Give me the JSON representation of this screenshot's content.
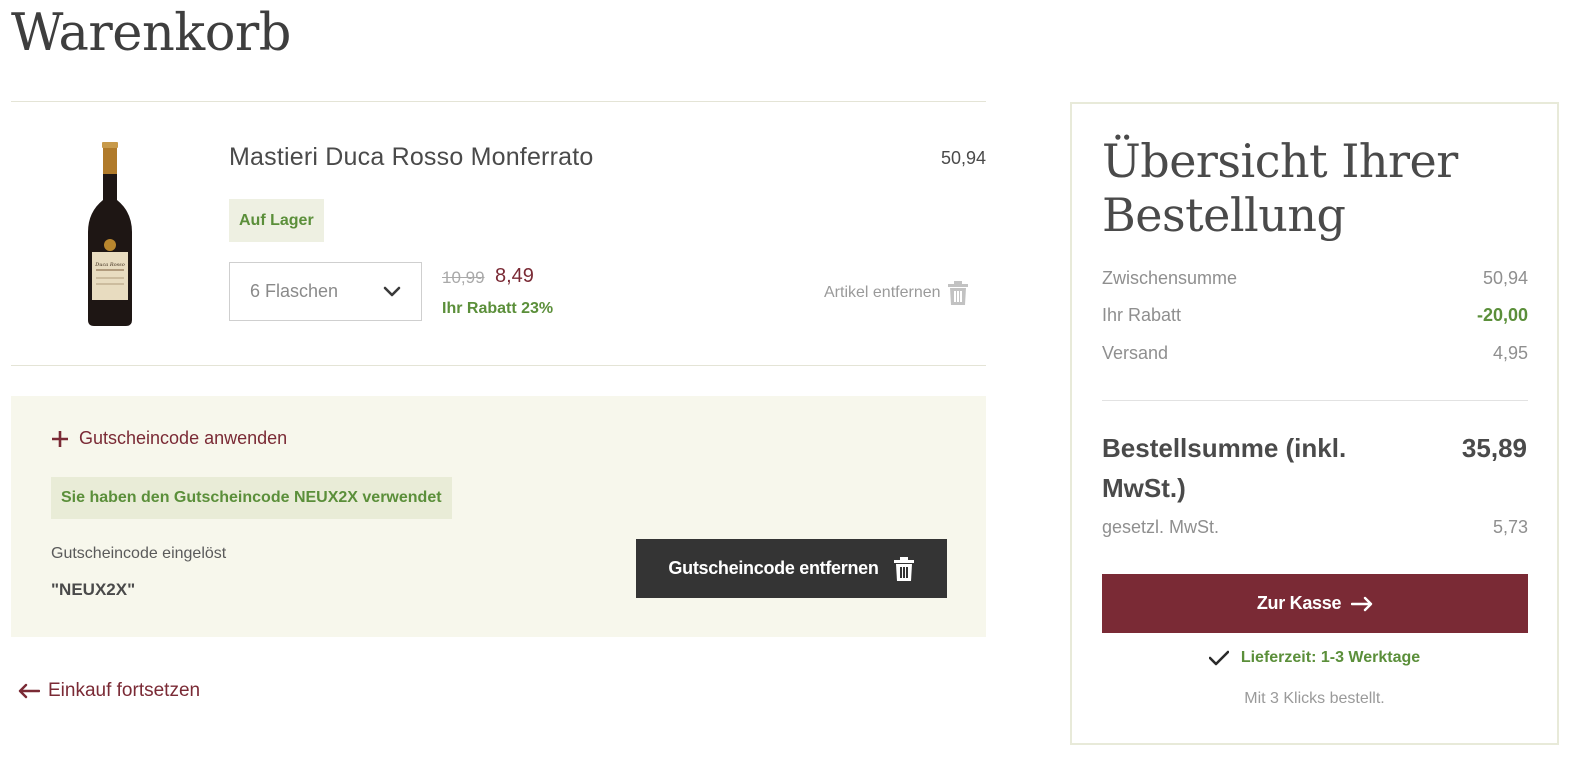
{
  "page": {
    "title": "Warenkorb"
  },
  "cart_item": {
    "name": "Mastieri Duca Rosso Monferrato",
    "line_total": "50,94",
    "stock_status": "Auf Lager",
    "quantity_selected": "6 Flaschen",
    "old_price": "10,99",
    "new_price": "8,49",
    "discount_note": "Ihr Rabatt 23%",
    "remove_label": "Artikel entfernen",
    "bottle_label_text": "Duca Rosso"
  },
  "voucher": {
    "toggle_label": "Gutscheincode anwenden",
    "applied_message": "Sie haben den Gutscheincode NEUX2X verwendet",
    "redeemed_label": "Gutscheincode eingelöst",
    "code": "\"NEUX2X\"",
    "remove_button_label": "Gutscheincode entfernen"
  },
  "continue_shopping": "Einkauf fortsetzen",
  "summary": {
    "title": "Übersicht Ihrer Bestellung",
    "rows": [
      {
        "label": "Zwischensumme",
        "value": "50,94"
      },
      {
        "label": "Ihr Rabatt",
        "value": "-20,00"
      },
      {
        "label": "Versand",
        "value": "4,95"
      }
    ],
    "total_label": "Bestellsumme (inkl. MwSt.)",
    "total_value": "35,89",
    "vat_label": "gesetzl. MwSt.",
    "vat_value": "5,73",
    "checkout_label": "Zur Kasse",
    "delivery_text": "Lieferzeit: 1-3 Werktage",
    "clicks_note": "Mit 3 Klicks bestellt."
  },
  "colors": {
    "brand_wine": "#7a2a35",
    "success_green": "#5b8f3a",
    "panel_beige": "#f7f7ec",
    "dark_button": "#343434"
  },
  "icons": [
    "chevron-down-icon",
    "trash-icon",
    "plus-icon",
    "arrow-left-icon",
    "arrow-right-icon",
    "checkmark-icon"
  ]
}
